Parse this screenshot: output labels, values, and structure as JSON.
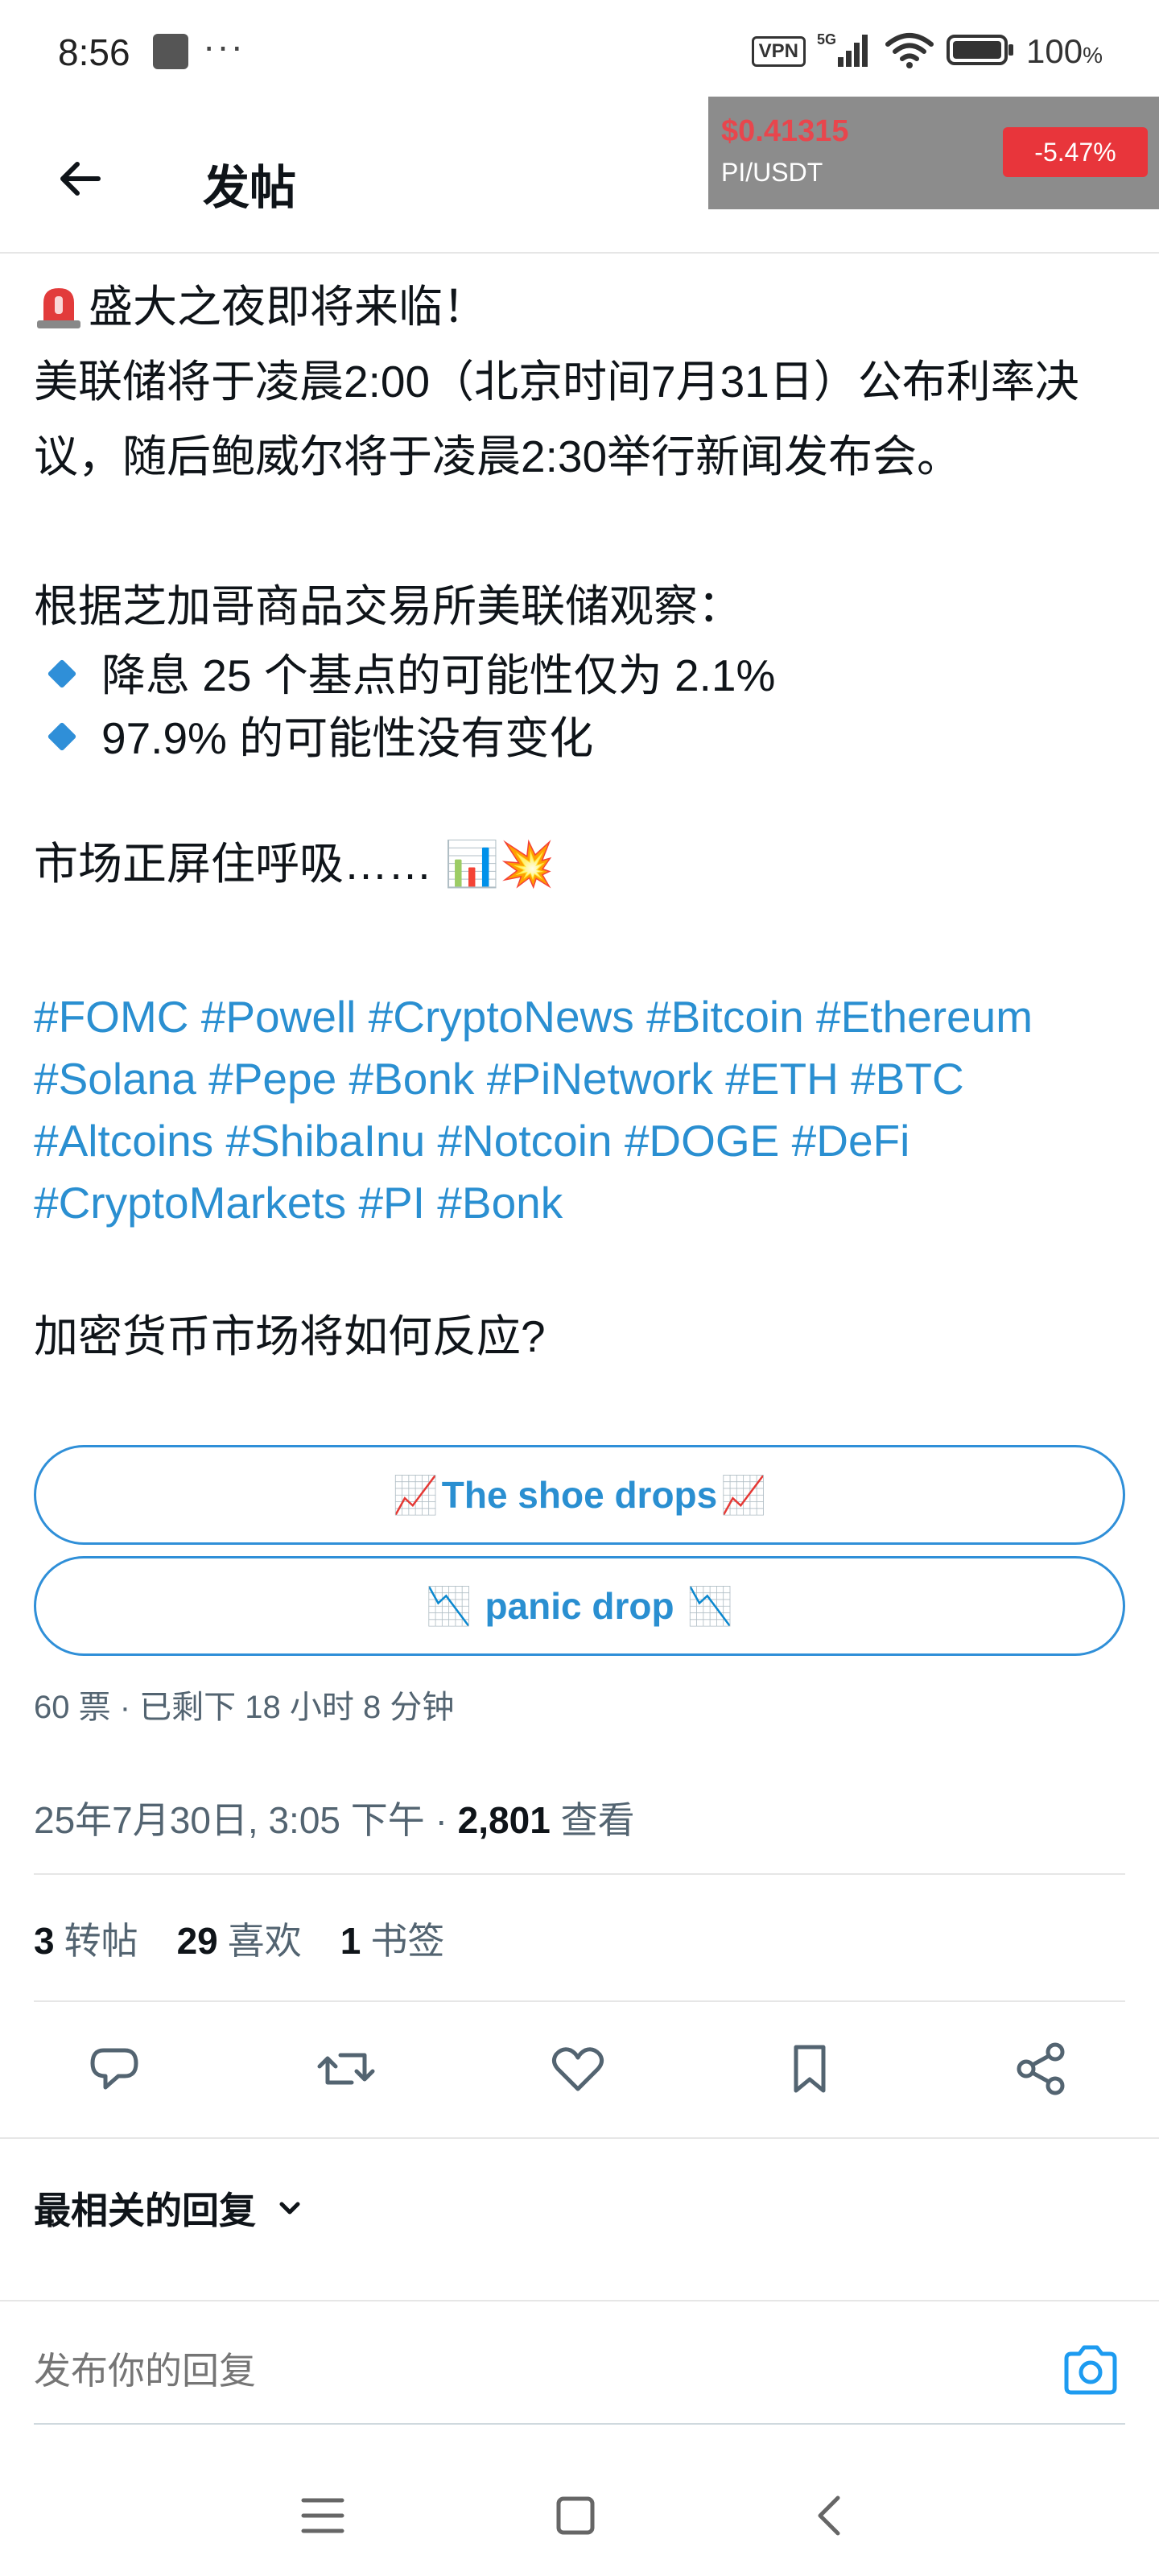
{
  "status_bar": {
    "time": "8:56",
    "dots": "···",
    "vpn": "VPN",
    "network": "5G",
    "battery": "100",
    "battery_unit": "%"
  },
  "header": {
    "title": "发帖"
  },
  "ticker": {
    "price": "$0.41315",
    "pair": "PI/USDT",
    "change": "-5.47%",
    "price_color": "#e8464d",
    "change_bg": "#e8353b"
  },
  "post": {
    "line1": "盛大之夜即将来临！",
    "line2": "美联储将于凌晨2:00（北京时间7月31日）公布利率决议，随后鲍威尔将于凌晨2:30举行新闻发布会。",
    "line3": "根据芝加哥商品交易所美联储观察：",
    "bullet1": "降息 25 个基点的可能性仅为 2.1%",
    "bullet2": "97.9% 的可能性没有变化",
    "line4": "市场正屏住呼吸…… 📊💥",
    "hashtags": [
      "#FOMC",
      "#Powell",
      "#CryptoNews",
      "#Bitcoin",
      "#Ethereum",
      "#Solana",
      "#Pepe",
      "#Bonk",
      "#PiNetwork",
      "#ETH",
      "#BTC",
      "#Altcoins",
      "#ShibaInu",
      "#Notcoin",
      "#DOGE",
      "#DeFi",
      "#CryptoMarkets",
      "#PI",
      "#Bonk"
    ],
    "question": "加密货币市场将如何反应?"
  },
  "poll": {
    "option1": "The shoe drops",
    "option1_icon": "📈",
    "option2": "panic drop",
    "option2_icon": "📉",
    "meta": "60 票 · 已剩下 18 小时 8 分钟"
  },
  "meta": {
    "timestamp": "25年7月30日, 3:05 下午 · ",
    "views_count": "2,801",
    "views_label": " 查看"
  },
  "stats": {
    "reposts_count": "3",
    "reposts_label": "转帖",
    "likes_count": "29",
    "likes_label": "喜欢",
    "bookmarks_count": "1",
    "bookmarks_label": "书签"
  },
  "replies": {
    "sort_label": "最相关的回复",
    "input_placeholder": "发布你的回复"
  },
  "colors": {
    "accent": "#2a8fd1",
    "text": "#0f1419",
    "muted": "#536471"
  }
}
